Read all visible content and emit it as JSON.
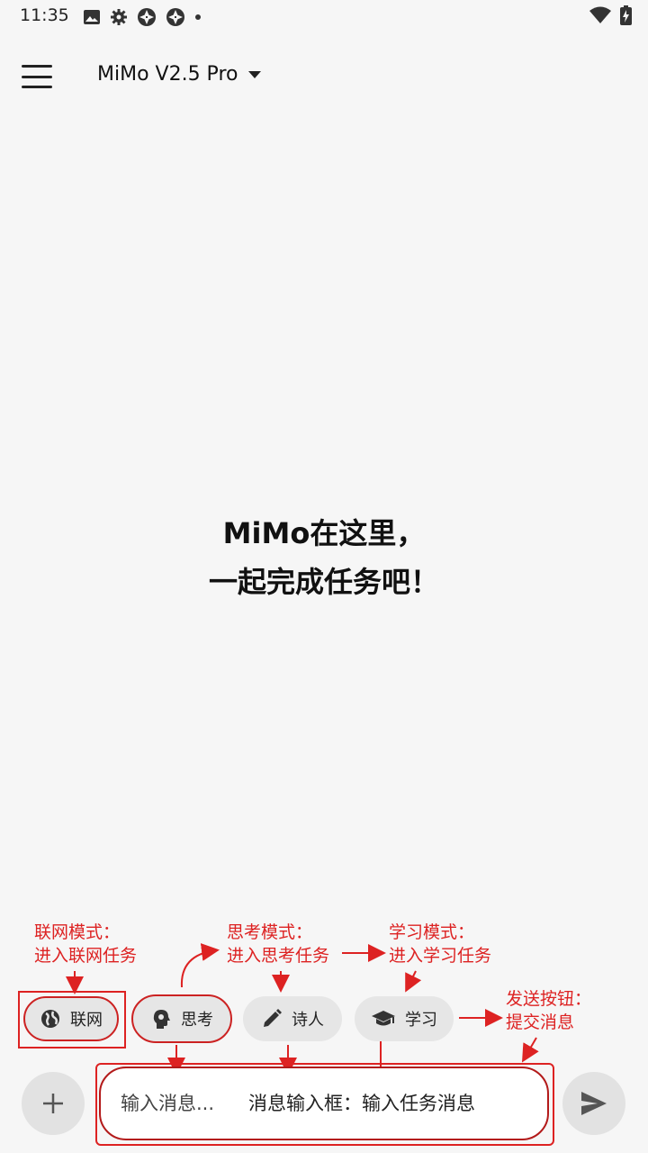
{
  "status": {
    "time": "11:35",
    "icons_left": [
      "image-icon",
      "settings-icon",
      "aperture-icon",
      "aperture-icon",
      "dot-icon"
    ],
    "icons_right": [
      "wifi-icon",
      "battery-icon"
    ]
  },
  "appbar": {
    "menu_icon": "menu-icon",
    "model_name": "MiMo V2.5 Pro"
  },
  "welcome": {
    "line1": "MiMo在这里，",
    "line2": "一起完成任务吧！"
  },
  "chips": [
    {
      "label": "联网",
      "icon": "globe-icon"
    },
    {
      "label": "思考",
      "icon": "brain-icon"
    },
    {
      "label": "诗人",
      "icon": "pencil-icon"
    },
    {
      "label": "学习",
      "icon": "graduation-cap-icon"
    }
  ],
  "input": {
    "placeholder": "输入消息...",
    "add_icon": "plus-icon",
    "send_icon": "send-icon"
  },
  "annotations": {
    "web_title": "联网模式：",
    "web_desc": "进入联网任务",
    "think_title": "思考模式：",
    "think_desc": "进入思考任务",
    "study_title": "学习模式：",
    "study_desc": "进入学习任务",
    "send_title": "发送按钮：",
    "send_desc": "提交消息",
    "input_desc": "消息输入框：输入任务消息"
  },
  "colors": {
    "annotation": "#dd2222",
    "background": "#f6f6f6",
    "chip": "#e6e6e6"
  }
}
